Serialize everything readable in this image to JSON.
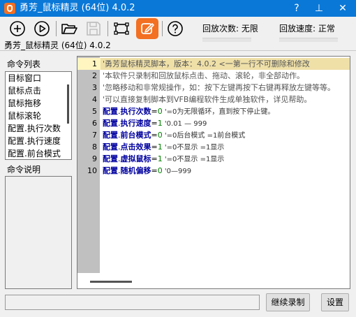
{
  "window": {
    "title": "勇芳_鼠标精灵 (64位) 4.0.2",
    "help_glyph": "?",
    "pin_glyph": "⊥",
    "close_glyph": "✕"
  },
  "app": {
    "subtitle": "勇芳_鼠标精灵 (64位) 4.0.2"
  },
  "toolbar": {
    "icons": [
      "add-icon",
      "play-icon",
      "folder-open-icon",
      "save-icon",
      "region-select-icon",
      "edit-icon",
      "help-icon"
    ],
    "accent": "#f36f21"
  },
  "status": {
    "play_count_label": "回放次数: 无限",
    "play_speed_label": "回放速度: 正常"
  },
  "command_list": {
    "title": "命令列表",
    "items": [
      "目标窗口",
      "鼠标点击",
      "鼠标拖移",
      "鼠标滚轮",
      "配置.执行次数",
      "配置.执行速度",
      "配置.前台模式"
    ]
  },
  "command_desc": {
    "title": "命令说明"
  },
  "editor": {
    "lines": [
      {
        "n": "1",
        "parts": [
          {
            "t": "'勇芳鼠标精灵脚本，版本：4.0.2  <一第一行不可删除和修改",
            "c": "c-comment"
          }
        ]
      },
      {
        "n": "2",
        "parts": [
          {
            "t": "'本软件只录制和回放鼠标点击、拖动、滚轮，非全部动作。",
            "c": "c-comment"
          }
        ]
      },
      {
        "n": "3",
        "parts": [
          {
            "t": "'忽略移动和非常规操作，如：按下左键再按下右键再释放左键等等。",
            "c": "c-comment"
          }
        ]
      },
      {
        "n": "4",
        "parts": [
          {
            "t": "'可以直接复制脚本到VFB编程软件生成单独软件，详见帮助。",
            "c": "c-comment"
          }
        ]
      },
      {
        "n": "5",
        "parts": [
          {
            "t": "配置",
            "c": "c-key"
          },
          {
            "t": ".",
            "c": "c-op"
          },
          {
            "t": "执行次数",
            "c": "c-key"
          },
          {
            "t": "=",
            "c": "c-op"
          },
          {
            "t": "0",
            "c": "c-num"
          },
          {
            "t": " '=0为无限循环，直到按下停止键。",
            "c": "c-cmt"
          }
        ]
      },
      {
        "n": "6",
        "parts": [
          {
            "t": "配置",
            "c": "c-key"
          },
          {
            "t": ".",
            "c": "c-op"
          },
          {
            "t": "执行速度",
            "c": "c-key"
          },
          {
            "t": "=",
            "c": "c-op"
          },
          {
            "t": "1",
            "c": "c-num"
          },
          {
            "t": " '0.01 — 999",
            "c": "c-cmt"
          }
        ]
      },
      {
        "n": "7",
        "parts": [
          {
            "t": "配置",
            "c": "c-key"
          },
          {
            "t": ".",
            "c": "c-op"
          },
          {
            "t": "前台模式",
            "c": "c-key"
          },
          {
            "t": "=",
            "c": "c-op"
          },
          {
            "t": "0",
            "c": "c-num"
          },
          {
            "t": " '=0后台模式 =1前台模式",
            "c": "c-cmt"
          }
        ]
      },
      {
        "n": "8",
        "parts": [
          {
            "t": "配置",
            "c": "c-key"
          },
          {
            "t": ".",
            "c": "c-op"
          },
          {
            "t": "点击效果",
            "c": "c-key"
          },
          {
            "t": "=",
            "c": "c-op"
          },
          {
            "t": "1",
            "c": "c-num"
          },
          {
            "t": " '=0不显示 =1显示",
            "c": "c-cmt"
          }
        ]
      },
      {
        "n": "9",
        "parts": [
          {
            "t": "配置",
            "c": "c-key"
          },
          {
            "t": ".",
            "c": "c-op"
          },
          {
            "t": "虚拟鼠标",
            "c": "c-key"
          },
          {
            "t": "=",
            "c": "c-op"
          },
          {
            "t": "1",
            "c": "c-num"
          },
          {
            "t": " '=0不显示 =1显示",
            "c": "c-cmt"
          }
        ]
      },
      {
        "n": "10",
        "parts": [
          {
            "t": "配置",
            "c": "c-key"
          },
          {
            "t": ".",
            "c": "c-op"
          },
          {
            "t": "随机偏移",
            "c": "c-key"
          },
          {
            "t": "=",
            "c": "c-op"
          },
          {
            "t": "0",
            "c": "c-num"
          },
          {
            "t": " '0—999",
            "c": "c-cmt"
          }
        ]
      }
    ]
  },
  "buttons": {
    "continue_record": "继续录制",
    "settings": "设置"
  }
}
